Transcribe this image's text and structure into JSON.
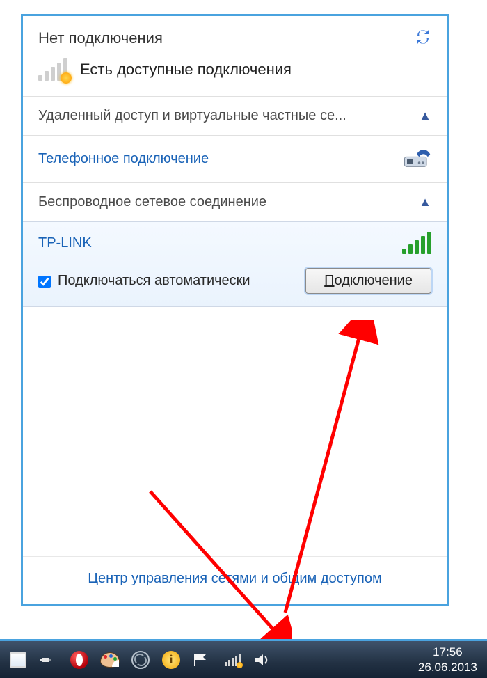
{
  "header": {
    "title": "Нет подключения",
    "available_text": "Есть доступные подключения"
  },
  "sections": {
    "vpn_label": "Удаленный доступ и виртуальные частные се...",
    "dialup_label": "Телефонное подключение",
    "wireless_label": "Беспроводное сетевое соединение"
  },
  "wifi": {
    "ssid": "TP-LINK",
    "auto_label": "Подключаться автоматически",
    "auto_checked": true,
    "connect_button_prefix": "П",
    "connect_button_rest": "одключение"
  },
  "footer": {
    "link": "Центр управления сетями и общим доступом"
  },
  "taskbar": {
    "time": "17:56",
    "date": "26.06.2013"
  }
}
